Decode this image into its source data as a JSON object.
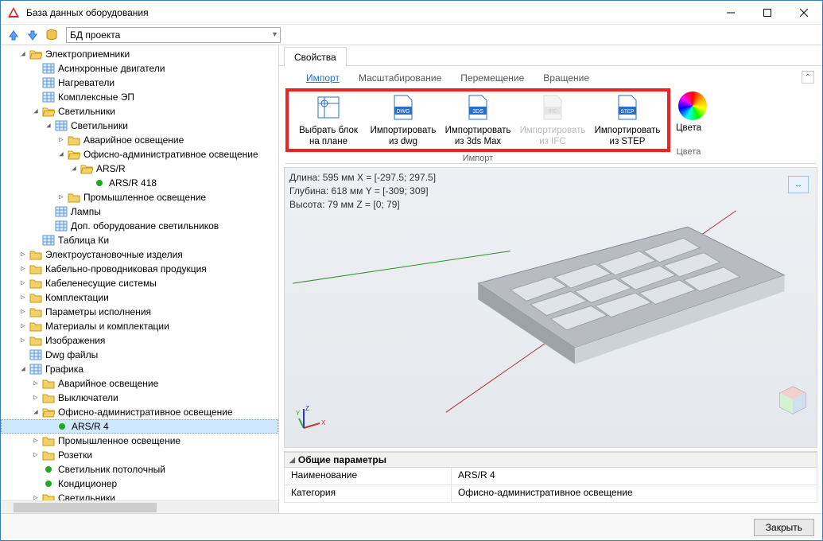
{
  "window": {
    "title": "База данных оборудования"
  },
  "toolbar": {
    "combo_value": "БД проекта"
  },
  "left_tabs": {
    "properties": "Свойства"
  },
  "ribbon": {
    "tabs": {
      "import": "Импорт",
      "scale": "Масштабирование",
      "move": "Перемещение",
      "rotate": "Вращение"
    },
    "buttons": {
      "select_block_l1": "Выбрать блок",
      "select_block_l2": "на плане",
      "import_dwg_l1": "Импортировать",
      "import_dwg_l2": "из dwg",
      "import_3ds_l1": "Импортировать",
      "import_3ds_l2": "из 3ds Max",
      "import_ifc_l1": "Импортировать",
      "import_ifc_l2": "из IFC",
      "import_step_l1": "Импортировать",
      "import_step_l2": "из STEP"
    },
    "group_import": "Импорт",
    "colors_l1": "Цвета",
    "colors_l2": "Цвета"
  },
  "viewport_info": {
    "l1": "Длина: 595 мм    X = [-297.5; 297.5]",
    "l2": "Глубина: 618 мм Y = [-309; 309]",
    "l3": "Высота: 79 мм    Z = [0; 79]"
  },
  "props": {
    "header": "Общие параметры",
    "rows": [
      {
        "k": "Наименование",
        "v": "ARS/R 4"
      },
      {
        "k": "Категория",
        "v": "Офисно-административное освещение"
      }
    ]
  },
  "footer": {
    "close": "Закрыть"
  },
  "tree": [
    {
      "d": 1,
      "t": "folder-open",
      "tg": "open",
      "label": "Электроприемники"
    },
    {
      "d": 2,
      "t": "table",
      "label": "Асинхронные двигатели"
    },
    {
      "d": 2,
      "t": "table",
      "label": "Нагреватели"
    },
    {
      "d": 2,
      "t": "table",
      "label": "Комплексные ЭП"
    },
    {
      "d": 2,
      "t": "folder-open",
      "tg": "open",
      "label": "Светильники"
    },
    {
      "d": 3,
      "t": "table",
      "tg": "open",
      "label": "Светильники"
    },
    {
      "d": 4,
      "t": "folder",
      "tg": "closed",
      "label": "Аварийное освещение"
    },
    {
      "d": 4,
      "t": "folder-open",
      "tg": "open",
      "label": "Офисно-административное освещение"
    },
    {
      "d": 5,
      "t": "folder-open",
      "tg": "open",
      "label": "ARS/R"
    },
    {
      "d": 6,
      "t": "dot",
      "label": "ARS/R 418"
    },
    {
      "d": 4,
      "t": "folder",
      "tg": "closed",
      "label": "Промышленное освещение"
    },
    {
      "d": 3,
      "t": "table",
      "label": "Лампы"
    },
    {
      "d": 3,
      "t": "table",
      "label": "Доп. оборудование светильников"
    },
    {
      "d": 2,
      "t": "table",
      "label": "Таблица Ки"
    },
    {
      "d": 1,
      "t": "folder",
      "tg": "closed",
      "label": "Электроустановочные изделия"
    },
    {
      "d": 1,
      "t": "folder",
      "tg": "closed",
      "label": "Кабельно-проводниковая продукция"
    },
    {
      "d": 1,
      "t": "folder",
      "tg": "closed",
      "label": "Кабеленесущие системы"
    },
    {
      "d": 1,
      "t": "folder",
      "tg": "closed",
      "label": "Комплектации"
    },
    {
      "d": 1,
      "t": "folder",
      "tg": "closed",
      "label": "Параметры исполнения"
    },
    {
      "d": 1,
      "t": "folder",
      "tg": "closed",
      "label": "Материалы и комплектации"
    },
    {
      "d": 1,
      "t": "folder",
      "tg": "closed",
      "label": "Изображения"
    },
    {
      "d": 1,
      "t": "table",
      "label": "Dwg файлы"
    },
    {
      "d": 1,
      "t": "table",
      "tg": "open",
      "label": "Графика"
    },
    {
      "d": 2,
      "t": "folder",
      "tg": "closed",
      "label": "Аварийное освещение"
    },
    {
      "d": 2,
      "t": "folder",
      "tg": "closed",
      "label": "Выключатели"
    },
    {
      "d": 2,
      "t": "folder-open",
      "tg": "open",
      "label": "Офисно-административное освещение"
    },
    {
      "d": 3,
      "t": "dot",
      "label": "ARS/R 4",
      "sel": true
    },
    {
      "d": 2,
      "t": "folder",
      "tg": "closed",
      "label": "Промышленное освещение"
    },
    {
      "d": 2,
      "t": "folder",
      "tg": "closed",
      "label": "Розетки"
    },
    {
      "d": 2,
      "t": "dot",
      "label": "Светильник потолочный"
    },
    {
      "d": 2,
      "t": "dot",
      "label": "Кондиционер"
    },
    {
      "d": 2,
      "t": "folder",
      "tg": "closed",
      "label": "Светильники"
    }
  ]
}
